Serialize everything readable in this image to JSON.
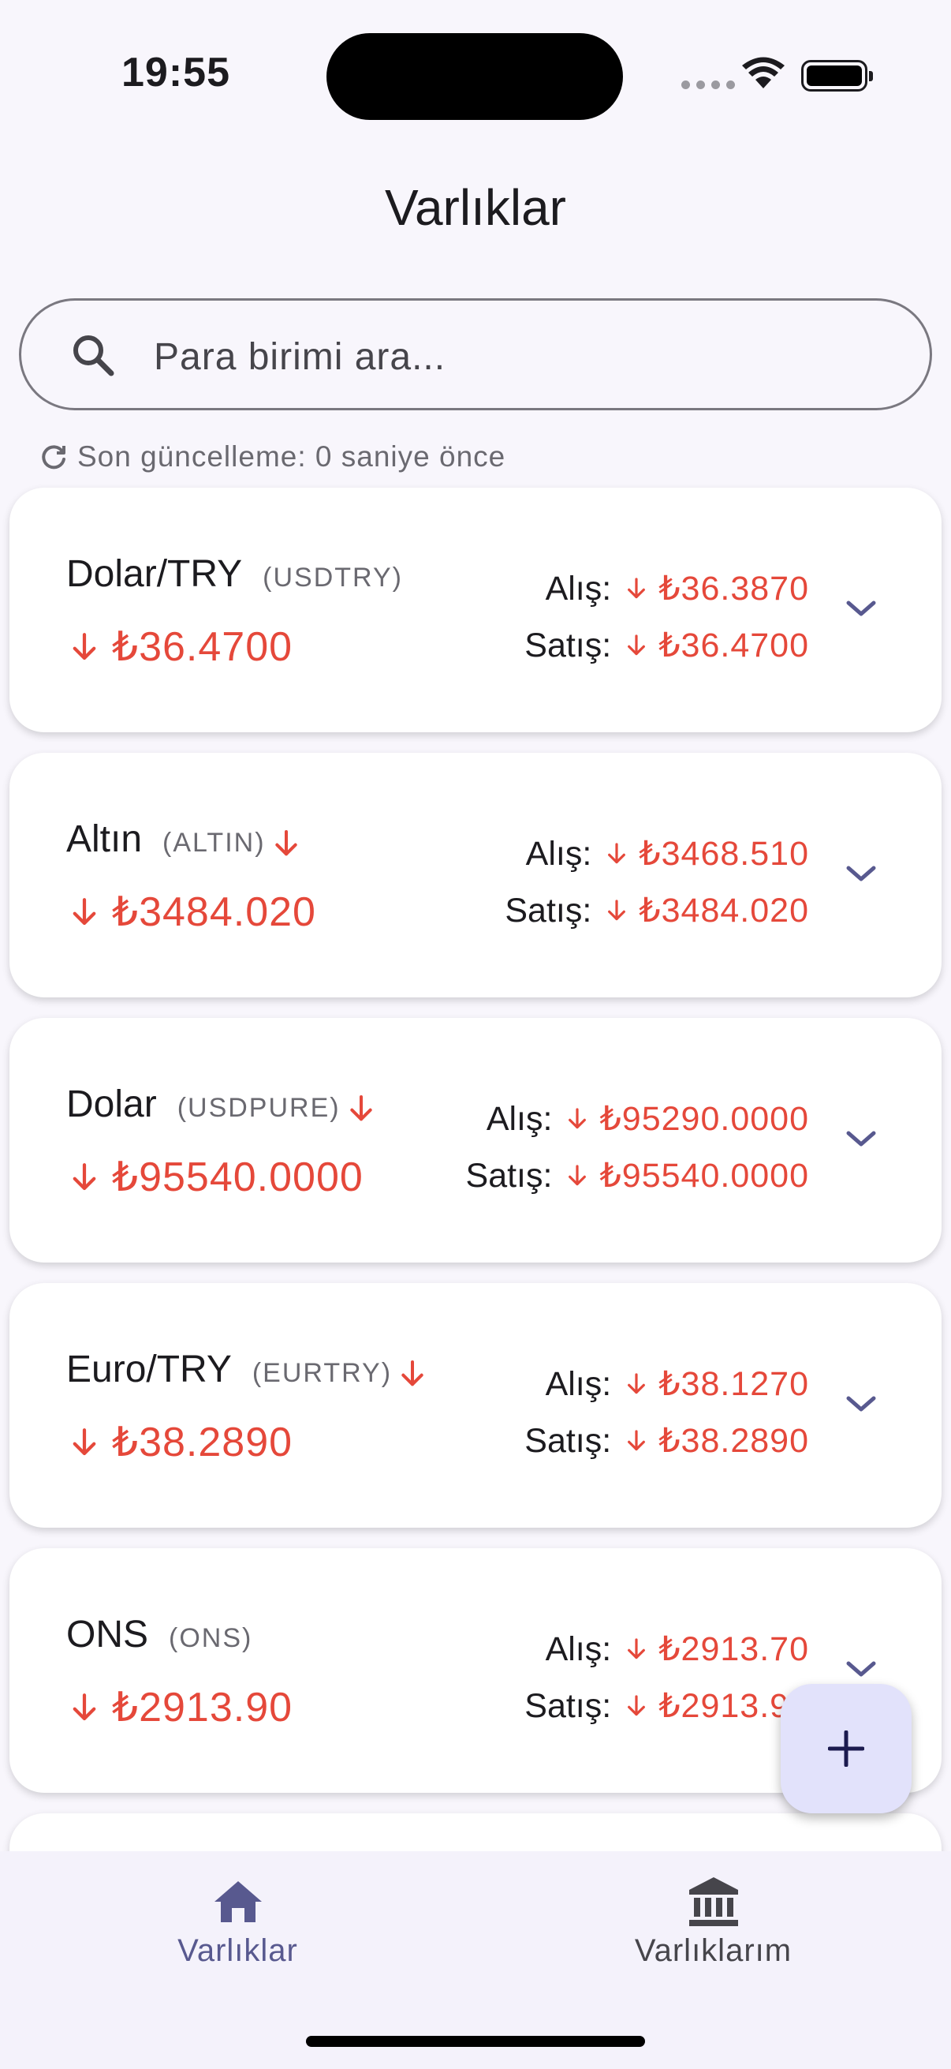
{
  "status_bar": {
    "time": "19:55"
  },
  "header": {
    "title": "Varlıklar"
  },
  "search": {
    "placeholder": "Para birimi ara..."
  },
  "last_update": "Son güncelleme: 0 saniye önce",
  "assets": [
    {
      "name": "Dolar/TRY",
      "code": "(USDTRY)",
      "code_trend": "none",
      "price": "₺36.4700",
      "buy_label": "Alış:",
      "buy": "₺36.3870",
      "sell_label": "Satış:",
      "sell": "₺36.4700",
      "trend": "down"
    },
    {
      "name": "Altın",
      "code": "(ALTIN)",
      "code_trend": "down",
      "price": "₺3484.020",
      "buy_label": "Alış:",
      "buy": "₺3468.510",
      "sell_label": "Satış:",
      "sell": "₺3484.020",
      "trend": "down"
    },
    {
      "name": "Dolar",
      "code": "(USDPURE)",
      "code_trend": "down",
      "price": "₺95540.0000",
      "buy_label": "Alış:",
      "buy": "₺95290.0000",
      "sell_label": "Satış:",
      "sell": "₺95540.0000",
      "trend": "down"
    },
    {
      "name": "Euro/TRY",
      "code": "(EURTRY)",
      "code_trend": "down",
      "price": "₺38.2890",
      "buy_label": "Alış:",
      "buy": "₺38.1270",
      "sell_label": "Satış:",
      "sell": "₺38.2890",
      "trend": "down"
    },
    {
      "name": "ONS",
      "code": "(ONS)",
      "code_trend": "none",
      "price": "₺2913.90",
      "buy_label": "Alış:",
      "buy": "₺2913.70",
      "sell_label": "Satış:",
      "sell": "₺2913.90",
      "trend": "down"
    }
  ],
  "nav": {
    "items": [
      {
        "label": "Varlıklar",
        "icon": "home-icon",
        "active": true
      },
      {
        "label": "Varlıklarım",
        "icon": "bank-icon",
        "active": false
      }
    ]
  },
  "fab": {
    "icon": "plus-icon"
  },
  "colors": {
    "down": "#e5483a",
    "accent": "#58598f",
    "fab_bg": "#e2e2fb",
    "background": "#f8f6fc"
  }
}
